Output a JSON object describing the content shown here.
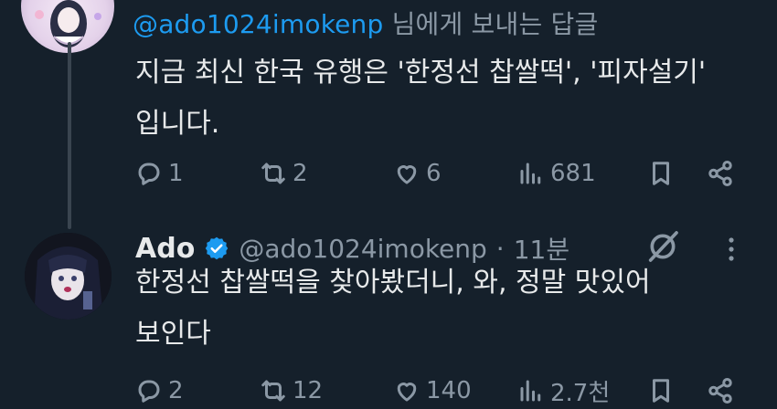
{
  "reply_context": {
    "handle": "@ado1024imokenp",
    "suffix": " 님에게 보내는 답글"
  },
  "tweet1": {
    "text_line1": "지금 최신 한국 유행은 '한정선 찹쌀떡', '피자설기'",
    "text_line2": "입니다.",
    "reply_count": "1",
    "retweet_count": "2",
    "like_count": "6",
    "view_count": "681"
  },
  "tweet2": {
    "name": "Ado",
    "handle": "@ado1024imokenp",
    "separator": "·",
    "time": "11분",
    "text_line1": "한정선 찹쌀떡을 찾아봤더니, 와, 정말 맛있어",
    "text_line2": "보인다",
    "reply_count": "2",
    "retweet_count": "12",
    "like_count": "140",
    "view_count": "2.7천"
  },
  "icons": {
    "reply": "reply-icon",
    "retweet": "retweet-icon",
    "like": "heart-icon",
    "views": "views-icon",
    "bookmark": "bookmark-icon",
    "share": "share-icon",
    "verified": "verified-badge-icon",
    "grok": "grok-icon",
    "more": "more-dots-icon"
  },
  "colors": {
    "background": "#15202b",
    "text": "#e7e9ea",
    "secondary": "#8b98a5",
    "accent": "#1d9bf0"
  }
}
